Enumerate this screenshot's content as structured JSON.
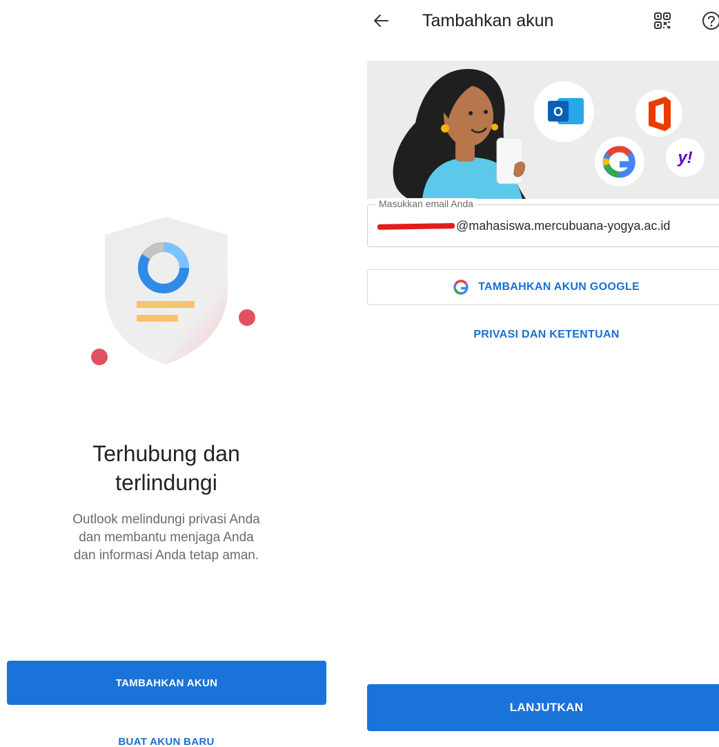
{
  "left_screen": {
    "title_line1": "Terhubung dan",
    "title_line2": "terlindungi",
    "description_line1": "Outlook melindungi privasi Anda",
    "description_line2": "dan membantu menjaga Anda",
    "description_line3": "dan informasi Anda tetap aman.",
    "add_account_button": "TAMBAHKAN AKUN",
    "create_account_link": "BUAT AKUN BARU",
    "illustration_icon": "shield-icon"
  },
  "right_screen": {
    "header": {
      "back_icon": "arrow-left-icon",
      "title": "Tambahkan akun",
      "qr_icon": "qr-code-icon",
      "help_icon": "help-icon"
    },
    "hero_icons": [
      "outlook-icon",
      "office-icon",
      "google-icon",
      "yahoo-icon"
    ],
    "email_field": {
      "label": "Masukkan email Anda",
      "value_visible": "@mahasiswa.mercubuana-yogya.ac.id",
      "value_redacted": true
    },
    "google_button": "TAMBAHKAN AKUN GOOGLE",
    "privacy_link": "PRIVASI DAN KETENTUAN",
    "continue_button": "LANJUTKAN"
  },
  "colors": {
    "primary_blue": "#1a73d9",
    "link_blue": "#1a6fd1",
    "redaction_red": "#e21d1d",
    "hero_background": "#ececec"
  }
}
